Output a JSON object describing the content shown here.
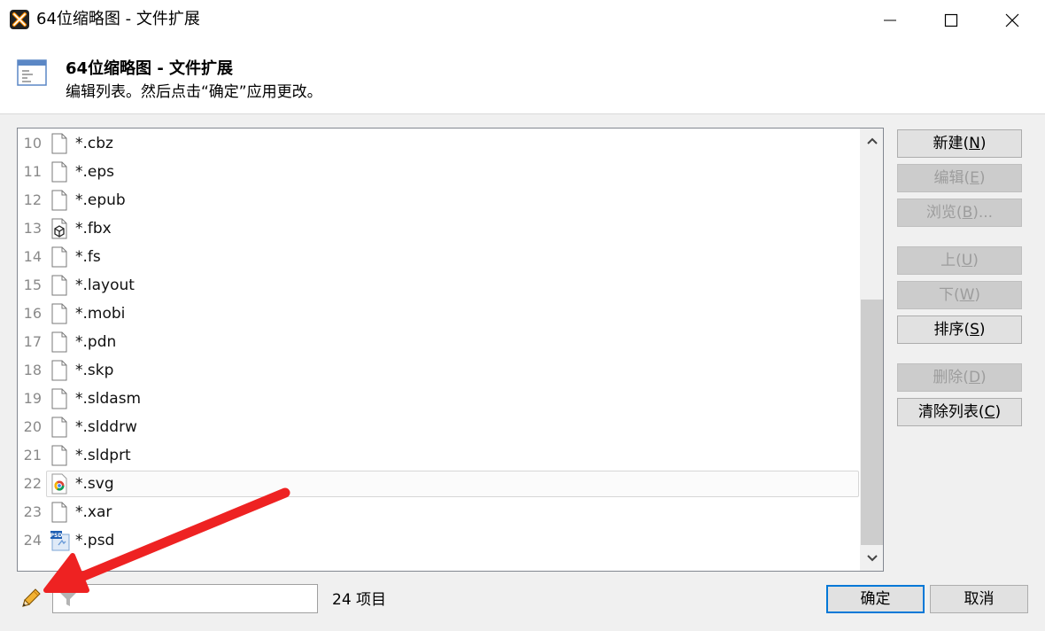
{
  "window": {
    "title": "64位缩略图 - 文件扩展",
    "app_icon": "xyplorer-x-icon",
    "controls": [
      "minimize-icon",
      "maximize-icon",
      "close-icon"
    ]
  },
  "header": {
    "title": "64位缩略图 - 文件扩展",
    "subtitle": "编辑列表。然后点击“确定”应用更改。",
    "icon": "list-window-icon"
  },
  "list": {
    "items": [
      {
        "num": "10",
        "name": "*.cbz",
        "icon": "blank-file-icon"
      },
      {
        "num": "11",
        "name": "*.eps",
        "icon": "blank-file-icon"
      },
      {
        "num": "12",
        "name": "*.epub",
        "icon": "blank-file-icon"
      },
      {
        "num": "13",
        "name": "*.fbx",
        "icon": "3d-cube-file-icon"
      },
      {
        "num": "14",
        "name": "*.fs",
        "icon": "blank-file-icon"
      },
      {
        "num": "15",
        "name": "*.layout",
        "icon": "blank-file-icon"
      },
      {
        "num": "16",
        "name": "*.mobi",
        "icon": "blank-file-icon"
      },
      {
        "num": "17",
        "name": "*.pdn",
        "icon": "blank-file-icon"
      },
      {
        "num": "18",
        "name": "*.skp",
        "icon": "blank-file-icon"
      },
      {
        "num": "19",
        "name": "*.sldasm",
        "icon": "blank-file-icon"
      },
      {
        "num": "20",
        "name": "*.slddrw",
        "icon": "blank-file-icon"
      },
      {
        "num": "21",
        "name": "*.sldprt",
        "icon": "blank-file-icon"
      },
      {
        "num": "22",
        "name": "*.svg",
        "icon": "chrome-file-icon",
        "selected": true
      },
      {
        "num": "23",
        "name": "*.xar",
        "icon": "blank-file-icon"
      },
      {
        "num": "24",
        "name": "*.psd",
        "icon": "psd-file-icon"
      }
    ]
  },
  "buttons": {
    "new": {
      "label": "新建(",
      "key": "N",
      "end": ")"
    },
    "edit": {
      "label": "编辑(",
      "key": "E",
      "end": ")"
    },
    "browse": {
      "label": "浏览(",
      "key": "B",
      "end": ")..."
    },
    "up": {
      "label": "上(",
      "key": "U",
      "end": ")"
    },
    "down": {
      "label": "下(",
      "key": "W",
      "end": ")"
    },
    "sort": {
      "label": "排序(",
      "key": "S",
      "end": ")"
    },
    "delete": {
      "label": "删除(",
      "key": "D",
      "end": ")"
    },
    "clear": {
      "label": "清除列表(",
      "key": "C",
      "end": ")"
    }
  },
  "footer": {
    "count": "24 项目",
    "ok": "确定",
    "cancel": "取消",
    "filter_value": "",
    "edit_icon": "pencil-icon",
    "filter_icon": "funnel-icon"
  },
  "colors": {
    "accent": "#0078d7",
    "annotation_arrow": "#ee2222"
  }
}
